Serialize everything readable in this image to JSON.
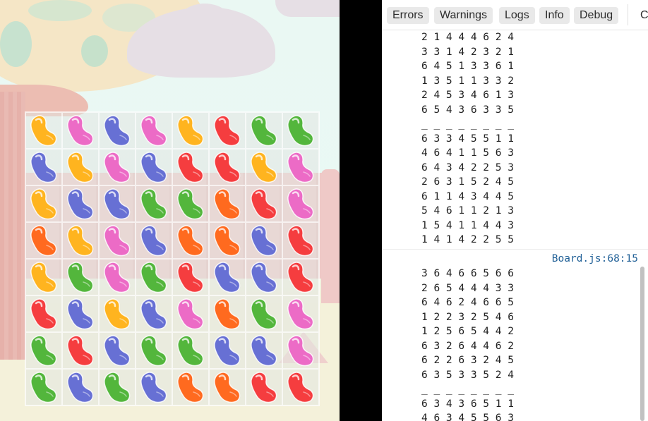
{
  "game": {
    "board_colors": {
      "yellow": "#ffb41f",
      "pink": "#ec6bc6",
      "blue": "#6770d4",
      "red": "#f53d3f",
      "green": "#53b63c",
      "orange": "#ff6a1f"
    },
    "board": [
      [
        "yellow",
        "pink",
        "blue",
        "pink",
        "yellow",
        "red",
        "green",
        "green"
      ],
      [
        "blue",
        "yellow",
        "pink",
        "blue",
        "red",
        "red",
        "yellow",
        "pink"
      ],
      [
        "yellow",
        "blue",
        "blue",
        "green",
        "green",
        "orange",
        "red",
        "pink"
      ],
      [
        "orange",
        "yellow",
        "pink",
        "blue",
        "orange",
        "orange",
        "blue",
        "red"
      ],
      [
        "yellow",
        "green",
        "pink",
        "green",
        "red",
        "blue",
        "blue",
        "red"
      ],
      [
        "red",
        "blue",
        "yellow",
        "blue",
        "pink",
        "orange",
        "green",
        "pink"
      ],
      [
        "green",
        "red",
        "blue",
        "green",
        "green",
        "blue",
        "blue",
        "pink"
      ],
      [
        "green",
        "blue",
        "green",
        "blue",
        "orange",
        "orange",
        "red",
        "red"
      ]
    ]
  },
  "console": {
    "filters": [
      "Errors",
      "Warnings",
      "Logs",
      "Info",
      "Debug"
    ],
    "clear_label": "C",
    "groups": [
      {
        "source": "",
        "lines": [
          "2 1 4 4 4 6 2 4",
          "3 3 1 4 2 3 2 1",
          "6 4 5 1 3 3 6 1",
          "1 3 5 1 1 3 3 2",
          "2 4 5 3 4 6 1 3",
          "6 5 4 3 6 3 3 5",
          "_ _ _ _ _ _ _ _",
          "6 3 3 4 5 5 1 1",
          "4 6 4 1 1 5 6 3",
          "6 4 3 4 2 2 5 3",
          "2 6 3 1 5 2 4 5",
          "6 1 1 4 3 4 4 5",
          "5 4 6 1 1 2 1 3",
          "1 5 4 1 1 4 4 3",
          "1 4 1 4 2 2 5 5"
        ]
      },
      {
        "source": "Board.js:68:15",
        "lines": [
          "3 6 4 6 6 5 6 6",
          "2 6 5 4 4 4 3 3",
          "6 4 6 2 4 6 6 5",
          "1 2 2 3 2 5 4 6",
          "1 2 5 6 5 4 4 2",
          "6 3 2 6 4 4 6 2",
          "6 2 2 6 3 2 4 5",
          "6 3 5 3 3 5 2 4",
          "_ _ _ _ _ _ _ _",
          "6 3 4 3 6 5 1 1",
          "4 6 3 4 5 5 6 3"
        ]
      }
    ]
  }
}
